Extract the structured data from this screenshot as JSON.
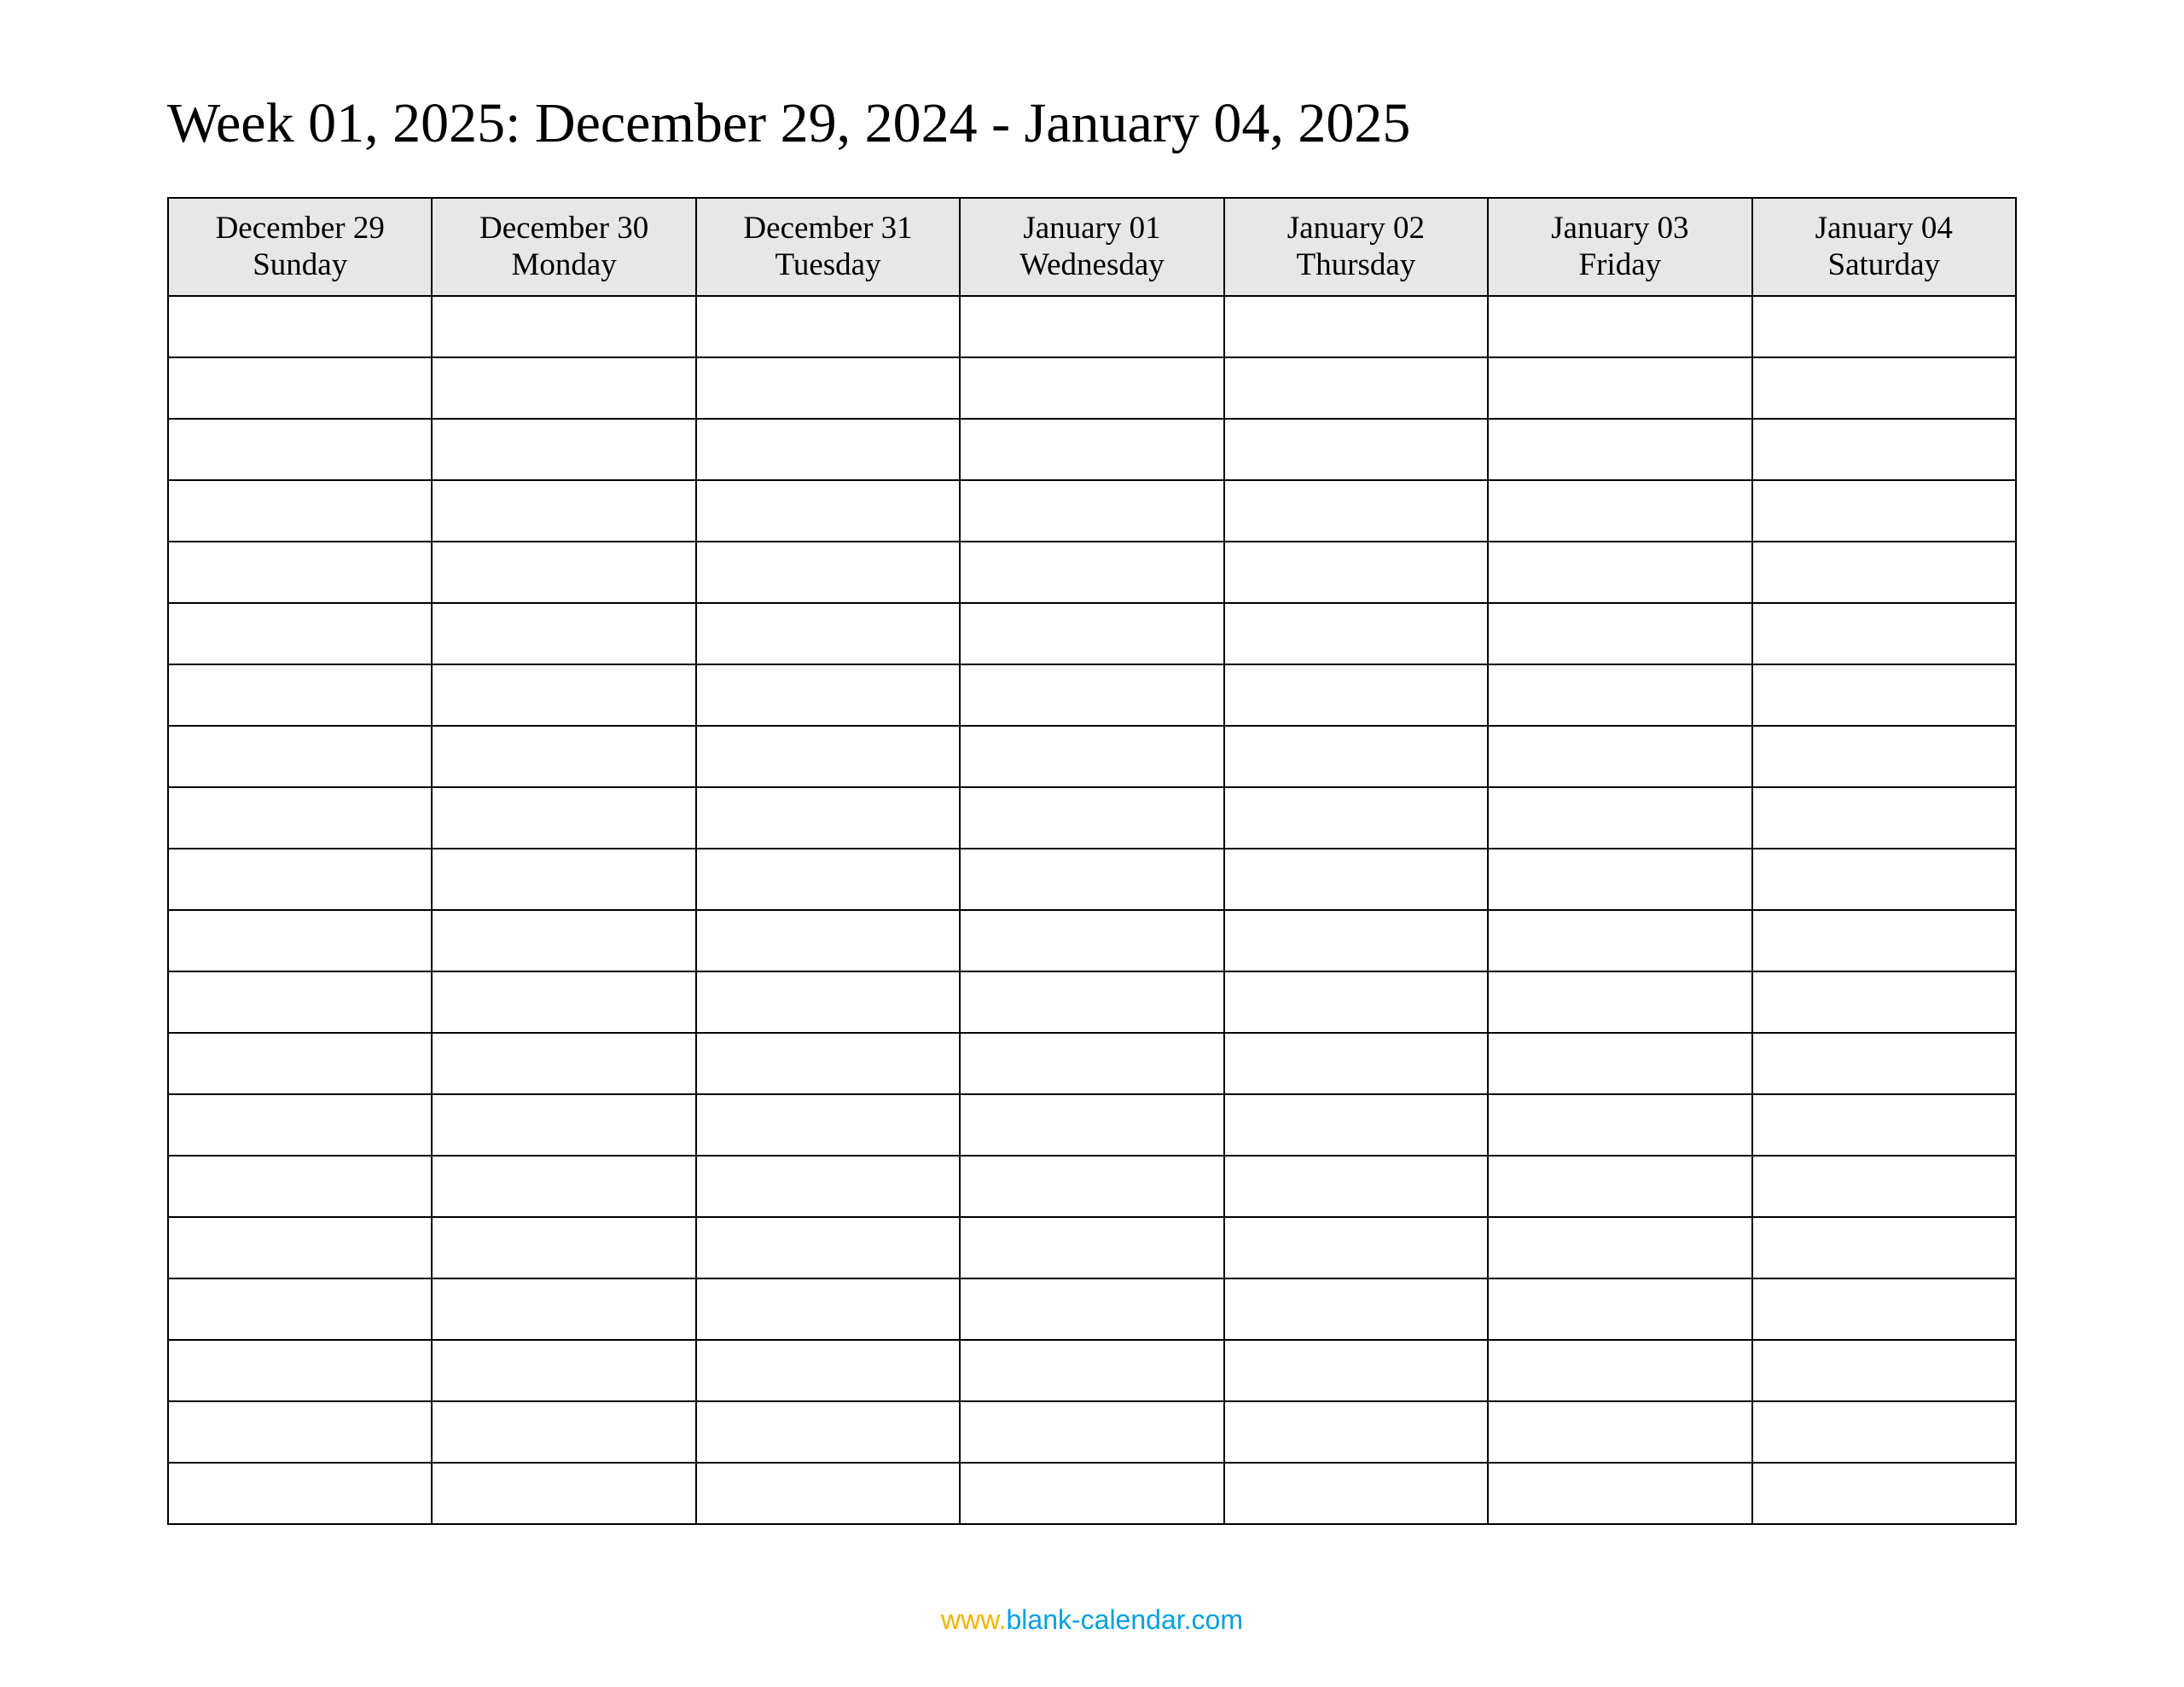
{
  "title": "Week 01, 2025: December 29, 2024 - January 04, 2025",
  "columns": [
    {
      "date": "December 29",
      "dow": "Sunday"
    },
    {
      "date": "December 30",
      "dow": "Monday"
    },
    {
      "date": "December 31",
      "dow": "Tuesday"
    },
    {
      "date": "January 01",
      "dow": "Wednesday"
    },
    {
      "date": "January 02",
      "dow": "Thursday"
    },
    {
      "date": "January 03",
      "dow": "Friday"
    },
    {
      "date": "January 04",
      "dow": "Saturday"
    }
  ],
  "body_row_count": 20,
  "footer": {
    "www": "www.",
    "domain": "blank-calendar.com"
  }
}
